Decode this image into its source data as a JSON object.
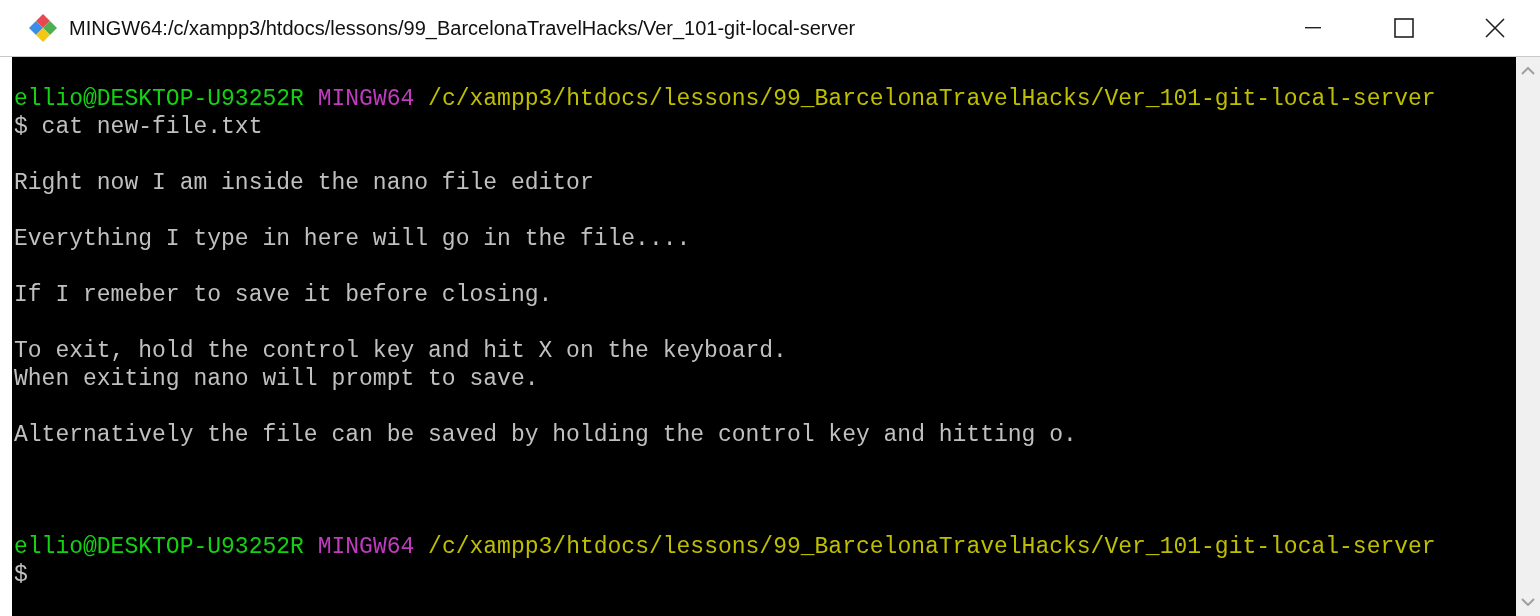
{
  "window": {
    "title": "MINGW64:/c/xampp3/htdocs/lessons/99_BarcelonaTravelHacks/Ver_101-git-local-server",
    "controls": [
      {
        "kind": "minimize"
      },
      {
        "kind": "maximize"
      },
      {
        "kind": "close"
      }
    ]
  },
  "terminal": {
    "lines": [
      {
        "kind": "prompt",
        "user_host": "ellio@DESKTOP-U93252R",
        "shell": "MINGW64",
        "path": "/c/xampp3/htdocs/lessons/99_BarcelonaTravelHacks/Ver_101-git-local-server"
      },
      {
        "kind": "command",
        "text": "$ cat new-file.txt"
      },
      {
        "kind": "blank"
      },
      {
        "kind": "output",
        "text": "Right now I am inside the nano file editor"
      },
      {
        "kind": "blank"
      },
      {
        "kind": "output",
        "text": "Everything I type in here will go in the file...."
      },
      {
        "kind": "blank"
      },
      {
        "kind": "output",
        "text": "If I remeber to save it before closing."
      },
      {
        "kind": "blank"
      },
      {
        "kind": "output",
        "text": "To exit, hold the control key and hit X on the keyboard."
      },
      {
        "kind": "output",
        "text": "When exiting nano will prompt to save."
      },
      {
        "kind": "blank"
      },
      {
        "kind": "output",
        "text": "Alternatively the file can be saved by holding the control key and hitting o."
      },
      {
        "kind": "blank"
      },
      {
        "kind": "blank"
      },
      {
        "kind": "blank"
      },
      {
        "kind": "prompt",
        "user_host": "ellio@DESKTOP-U93252R",
        "shell": "MINGW64",
        "path": "/c/xampp3/htdocs/lessons/99_BarcelonaTravelHacks/Ver_101-git-local-server"
      },
      {
        "kind": "command",
        "text": "$"
      }
    ]
  }
}
